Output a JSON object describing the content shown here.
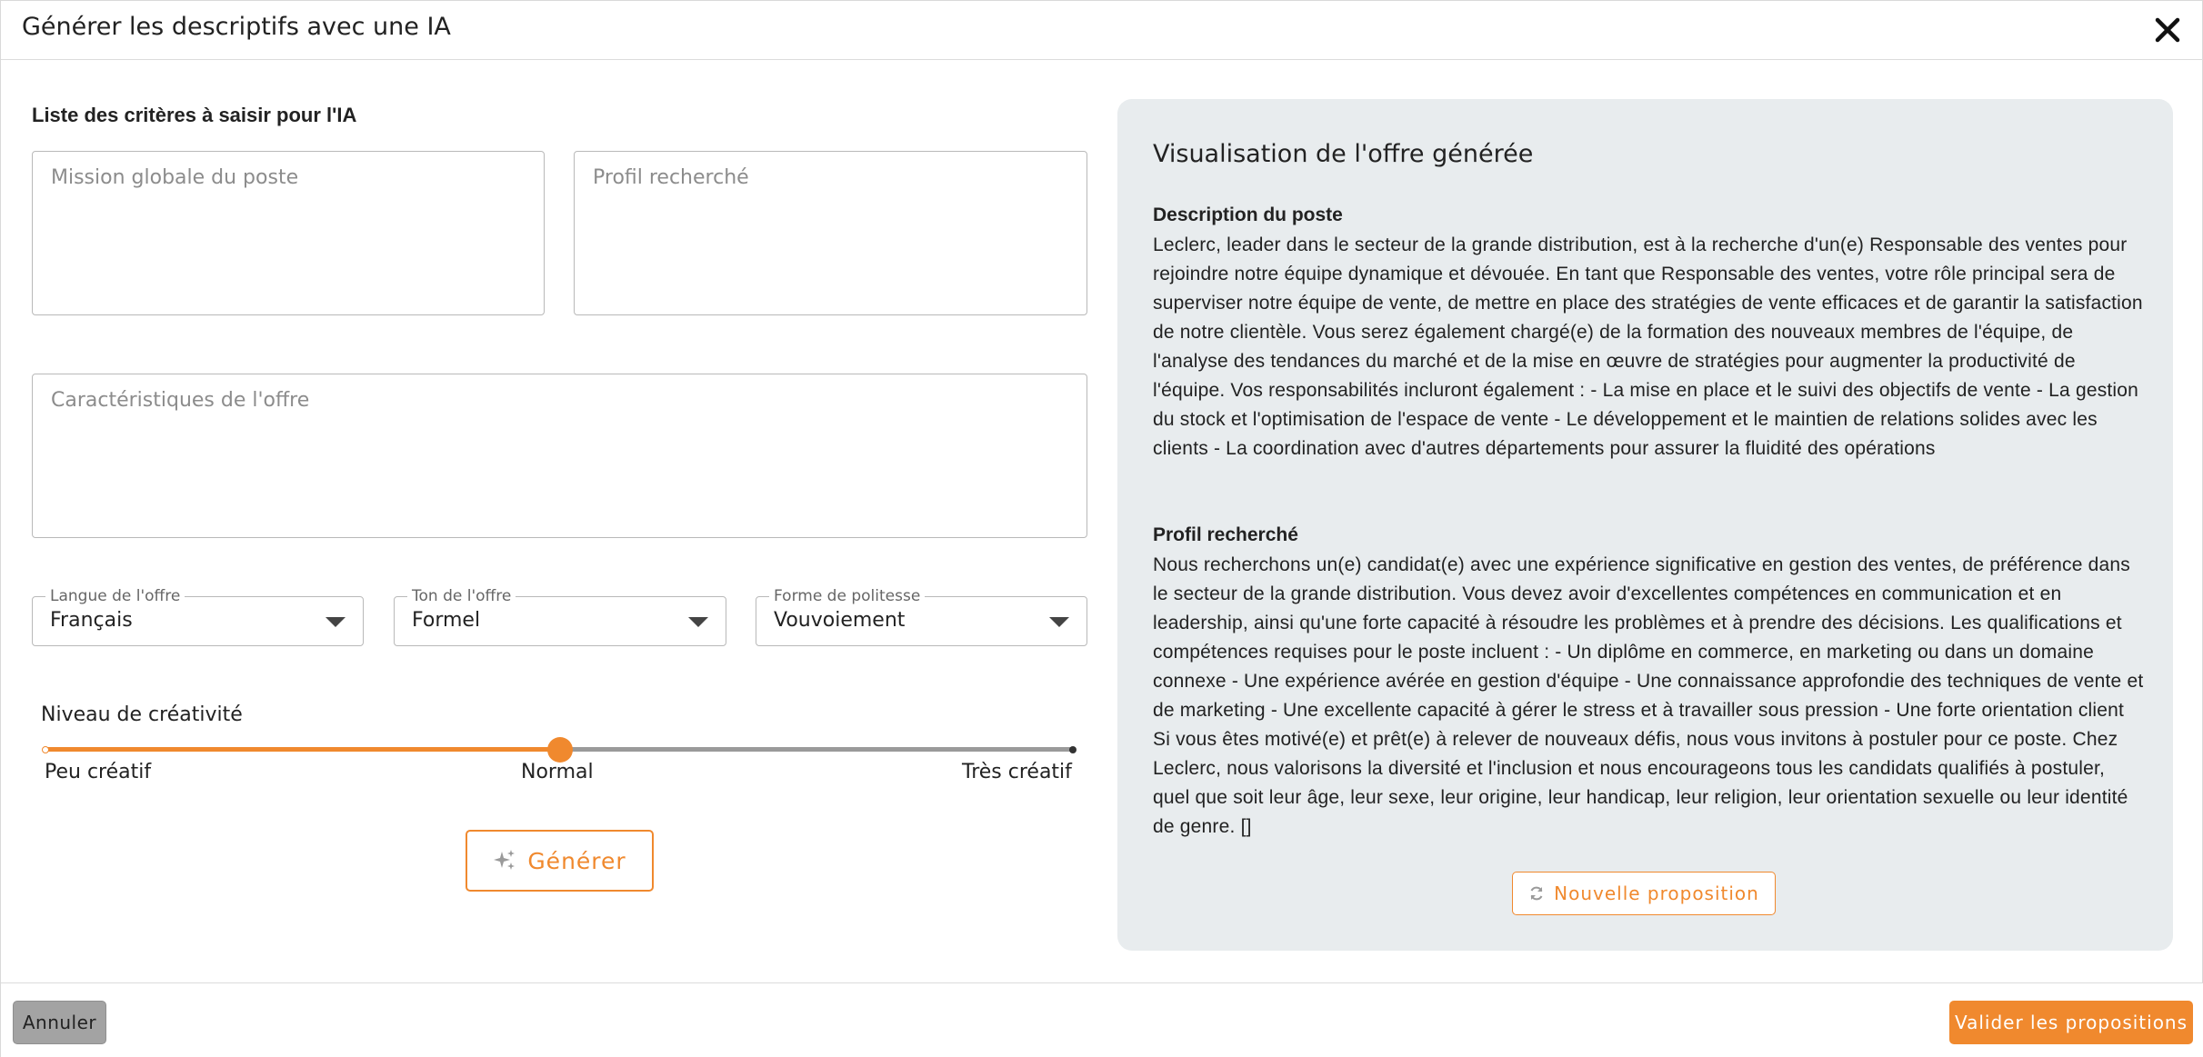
{
  "modal": {
    "title": "Générer les descriptifs avec une IA"
  },
  "form": {
    "section_title": "Liste des critères à saisir pour l'IA",
    "mission": {
      "placeholder": "Mission globale du poste",
      "value": ""
    },
    "profile": {
      "placeholder": "Profil recherché",
      "value": ""
    },
    "characteristics": {
      "placeholder": "Caractéristiques de l'offre",
      "value": ""
    },
    "language": {
      "label": "Langue de l'offre",
      "value": "Français"
    },
    "tone": {
      "label": "Ton de l'offre",
      "value": "Formel"
    },
    "politeness": {
      "label": "Forme de politesse",
      "value": "Vouvoiement"
    },
    "creativity": {
      "label": "Niveau de créativité",
      "min_label": "Peu créatif",
      "mid_label": "Normal",
      "max_label": "Très créatif",
      "level": 0.5
    },
    "generate_label": "Générer"
  },
  "preview": {
    "title": "Visualisation de l'offre générée",
    "description_title": "Description du poste",
    "description_text": "Leclerc, leader dans le secteur de la grande distribution, est à la recherche d'un(e) Responsable des ventes pour rejoindre notre équipe dynamique et dévouée. En tant que Responsable des ventes, votre rôle principal sera de superviser notre équipe de vente, de mettre en place des stratégies de vente efficaces et de garantir la satisfaction de notre clientèle. Vous serez également chargé(e) de la formation des nouveaux membres de l'équipe, de l'analyse des tendances du marché et de la mise en œuvre de stratégies pour augmenter la productivité de l'équipe. Vos responsabilités incluront également : - La mise en place et le suivi des objectifs de vente - La gestion du stock et l'optimisation de l'espace de vente - Le développement et le maintien de relations solides avec les clients - La coordination avec d'autres départements pour assurer la fluidité des opérations",
    "profile_title": "Profil recherché",
    "profile_text": "Nous recherchons un(e) candidat(e) avec une expérience significative en gestion des ventes, de préférence dans le secteur de la grande distribution. Vous devez avoir d'excellentes compétences en communication et en leadership, ainsi qu'une forte capacité à résoudre les problèmes et à prendre des décisions. Les qualifications et compétences requises pour le poste incluent : - Un diplôme en commerce, en marketing ou dans un domaine connexe - Une expérience avérée en gestion d'équipe - Une connaissance approfondie des techniques de vente et de marketing - Une excellente capacité à gérer le stress et à travailler sous pression - Une forte orientation client Si vous êtes motivé(e) et prêt(e) à relever de nouveaux défis, nous vous invitons à postuler pour ce poste. Chez Leclerc, nous valorisons la diversité et l'inclusion et nous encourageons tous les candidats qualifiés à postuler, quel que soit leur âge, leur sexe, leur origine, leur handicap, leur religion, leur orientation sexuelle ou leur identité de genre. []",
    "new_proposal_label": "Nouvelle proposition"
  },
  "footer": {
    "cancel_label": "Annuler",
    "validate_label": "Valider les propositions"
  },
  "colors": {
    "accent": "#f0892e",
    "preview_bg": "#e8ecee",
    "cancel_bg": "#a3a3a3"
  },
  "icons": {
    "close": "close-icon",
    "generate": "sparkles-icon",
    "new_proposal": "refresh-icon",
    "dropdown": "caret-down-icon"
  }
}
